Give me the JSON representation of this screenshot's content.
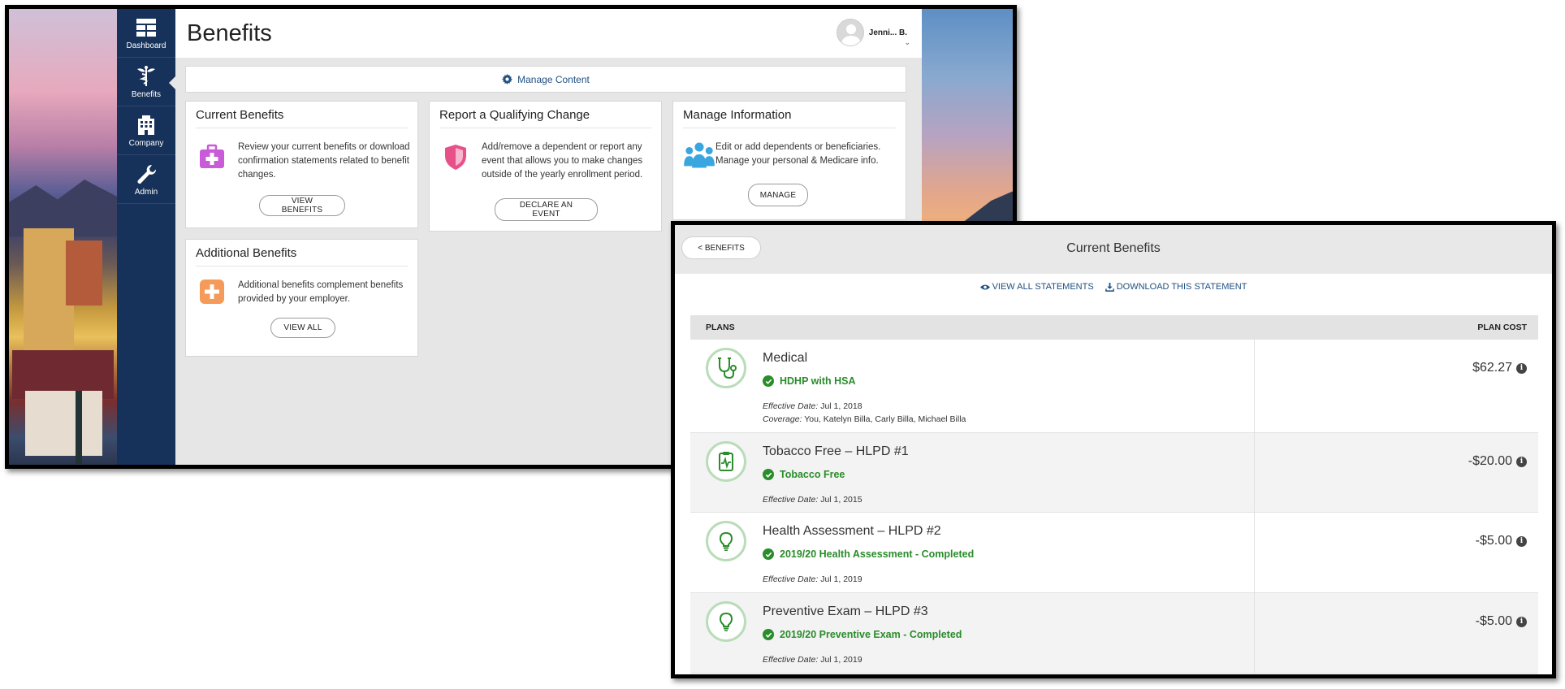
{
  "dashboard": {
    "title": "Benefits",
    "user_name": "Jenni... B.",
    "user_caret": "⌄",
    "manage_content": "Manage Content",
    "sidebar": [
      {
        "label": "Dashboard",
        "icon": "dashboard-icon"
      },
      {
        "label": "Benefits",
        "icon": "caduceus-icon"
      },
      {
        "label": "Company",
        "icon": "building-icon"
      },
      {
        "label": "Admin",
        "icon": "wrench-icon"
      }
    ],
    "cards": {
      "current": {
        "title": "Current Benefits",
        "desc": "Review your current benefits or download confirmation statements related to benefit changes.",
        "button": "VIEW BENEFITS",
        "icon": "first-aid-kit-icon",
        "color": "#c95bd8"
      },
      "qualifying": {
        "title": "Report a Qualifying Change",
        "desc": "Add/remove a dependent or report any event that allows you to make changes outside of the yearly enrollment period.",
        "button": "DECLARE AN EVENT",
        "icon": "shield-icon",
        "color": "#e8508a"
      },
      "manage": {
        "title": "Manage Information",
        "desc": "Edit or add dependents or beneficiaries. Manage your personal & Medicare info.",
        "button": "MANAGE",
        "icon": "people-icon",
        "color": "#3aa6e0"
      },
      "additional": {
        "title": "Additional Benefits",
        "desc": "Additional benefits complement benefits provided by your employer.",
        "button": "VIEW ALL",
        "icon": "plus-square-icon",
        "color": "#f59a58"
      }
    }
  },
  "detail": {
    "back_label": "< BENEFITS",
    "title": "Current Benefits",
    "view_all": "VIEW ALL STATEMENTS",
    "download": "DOWNLOAD THIS STATEMENT",
    "col_plans": "PLANS",
    "col_cost": "PLAN COST",
    "plans": [
      {
        "name": "Medical",
        "status": "HDHP with HSA",
        "effective_label": "Effective Date:",
        "effective": "Jul 1, 2018",
        "coverage_label": "Coverage:",
        "coverage": "You, Katelyn Billa, Carly Billa, Michael Billa",
        "cost": "$62.27",
        "icon": "stethoscope-icon"
      },
      {
        "name": "Tobacco Free – HLPD #1",
        "status": "Tobacco Free",
        "effective_label": "Effective Date:",
        "effective": "Jul 1, 2015",
        "cost": "-$20.00",
        "icon": "clipboard-pulse-icon"
      },
      {
        "name": "Health Assessment – HLPD #2",
        "status": "2019/20 Health Assessment - Completed",
        "effective_label": "Effective Date:",
        "effective": "Jul 1, 2019",
        "cost": "-$5.00",
        "icon": "lightbulb-icon"
      },
      {
        "name": "Preventive Exam – HLPD #3",
        "status": "2019/20 Preventive Exam - Completed",
        "effective_label": "Effective Date:",
        "effective": "Jul 1, 2019",
        "cost": "-$5.00",
        "icon": "lightbulb-icon"
      }
    ],
    "accent_green": "#2a8c2a",
    "link_blue": "#1f4f82"
  }
}
